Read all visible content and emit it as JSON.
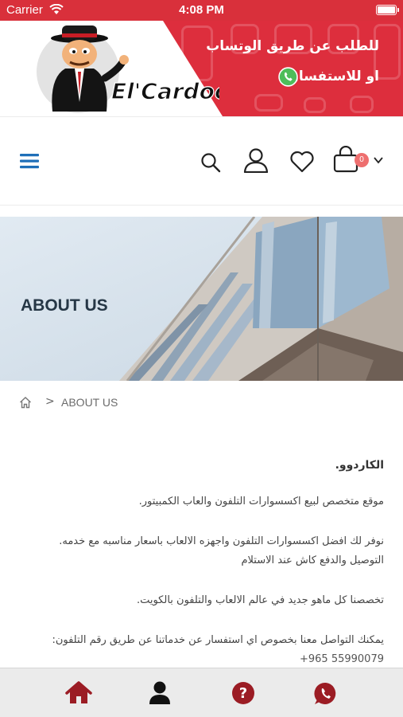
{
  "status_bar": {
    "carrier": "Carrier",
    "time": "4:08 PM"
  },
  "banner": {
    "logo_text": "El'Cardoo",
    "cta_line1": "للطلب عن طريق الوتساب",
    "cta_line2": "او للاستفسار",
    "cta_icon": "whatsapp-icon",
    "accent": "#dd2e3d"
  },
  "header": {
    "menu_icon": "hamburger-menu-icon",
    "search_icon": "search-icon",
    "account_icon": "user-icon",
    "wishlist_icon": "heart-icon",
    "cart_icon": "shopping-bag-icon",
    "cart_count": "0",
    "dropdown_icon": "chevron-down-icon",
    "accent": "#1f6fb8"
  },
  "hero": {
    "title": "ABOUT US"
  },
  "breadcrumb": {
    "home_icon": "home-icon",
    "separator": ">",
    "current": "ABOUT US"
  },
  "content": {
    "title": "الكاردوو.",
    "p1": "موقع متخصص لبيع اكسسوارات التلفون والعاب الكمبيتور.",
    "p2_line1": "نوفر لك افضل اكسسوارات التلفون واجهزه الالعاب باسعار مناسبه مع خدمه.",
    "p2_line2": "التوصيل والدفع كاش عند الاستلام",
    "p3": "تخصصنا كل ماهو جديد في عالم الالعاب والتلفون بالكويت.",
    "p4": "يمكنك التواصل معنا بخصوص اي استفسار عن خدماتنا عن طريق رقم التلفون:",
    "phone": "+965 55990079"
  },
  "tabbar": {
    "tabs": [
      {
        "icon": "home-icon",
        "color": "#9b1c24"
      },
      {
        "icon": "user-icon",
        "color": "#111111"
      },
      {
        "icon": "help-icon",
        "color": "#9b1c24"
      },
      {
        "icon": "whatsapp-icon",
        "color": "#9b1c24"
      }
    ]
  }
}
